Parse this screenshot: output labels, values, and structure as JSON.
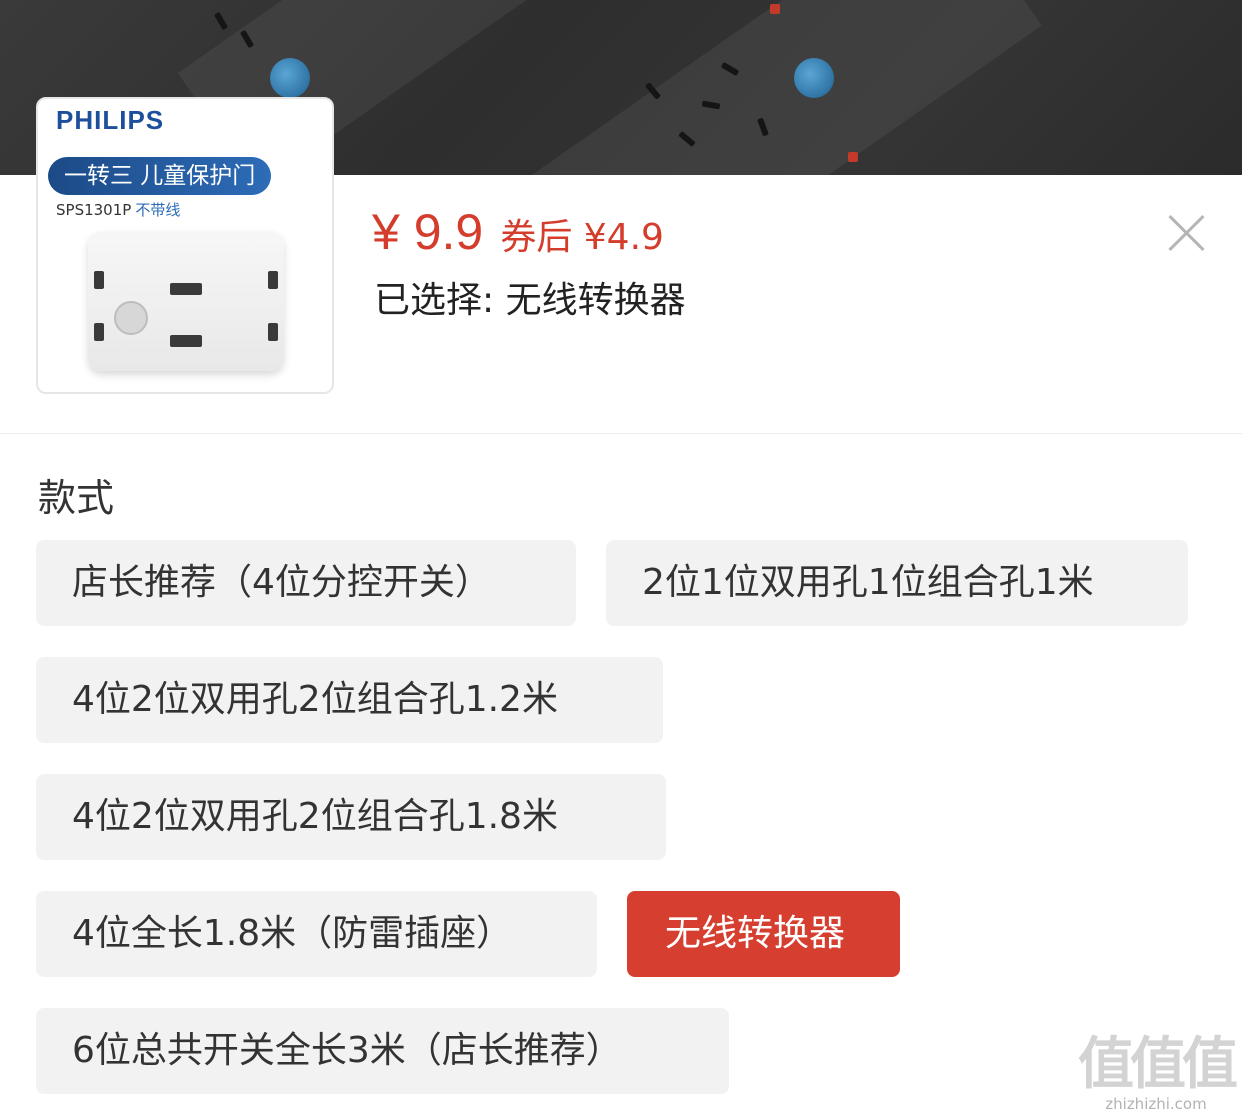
{
  "product": {
    "brand": "PHILIPS",
    "tagline": "一转三 儿童保护门",
    "model": "SPS1301P",
    "model_note": "不带线"
  },
  "price": {
    "current": "¥ 9.9",
    "after_coupon": "券后 ¥4.9",
    "color": "#d43c2c"
  },
  "selection": {
    "text": "已选择: 无线转换器"
  },
  "close": {
    "icon": "close-icon"
  },
  "style_section": {
    "title": "款式",
    "options": [
      {
        "label": "店长推荐（4位分控开关）",
        "selected": false
      },
      {
        "label": "2位1位双用孔1位组合孔1米",
        "selected": false
      },
      {
        "label": "4位2位双用孔2位组合孔1.2米",
        "selected": false
      },
      {
        "label": "4位2位双用孔2位组合孔1.8米",
        "selected": false
      },
      {
        "label": "4位全长1.8米（防雷插座）",
        "selected": false
      },
      {
        "label": "无线转换器",
        "selected": true
      },
      {
        "label": "6位总共开关全长3米（店长推荐）",
        "selected": false
      }
    ],
    "active_color": "#d63e30"
  },
  "watermark": {
    "logo": "值值值",
    "site": "zhizhizhi.com"
  }
}
